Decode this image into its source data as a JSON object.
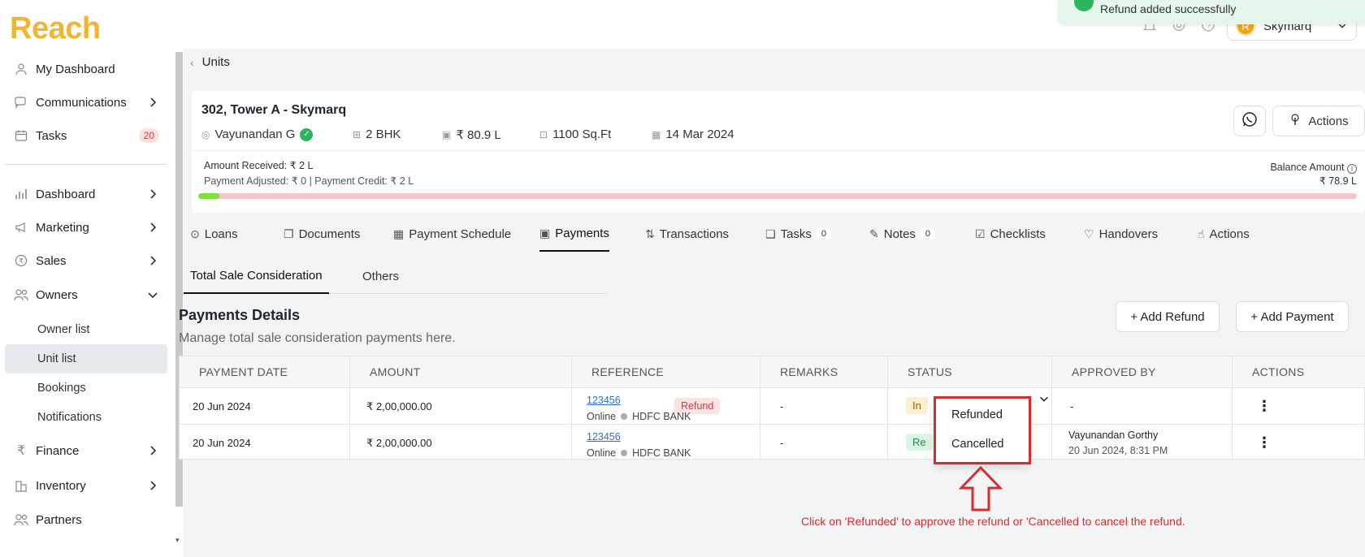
{
  "app": {
    "logo": "Reach"
  },
  "sidebar": {
    "top_items": [
      {
        "label": "My Dashboard",
        "icon": "user-icon"
      },
      {
        "label": "Communications",
        "icon": "chat-icon"
      },
      {
        "label": "Tasks",
        "icon": "calendar-icon",
        "badge": "20"
      }
    ],
    "items": [
      {
        "label": "Dashboard",
        "icon": "bar-chart-icon"
      },
      {
        "label": "Marketing",
        "icon": "megaphone-icon"
      },
      {
        "label": "Sales",
        "icon": "rupee-coin-icon"
      },
      {
        "label": "Owners",
        "icon": "users-icon"
      }
    ],
    "owners_sub": [
      "Owner list",
      "Unit list",
      "Bookings",
      "Notifications"
    ],
    "bottom_items": [
      {
        "label": "Finance",
        "icon": "rupee-icon"
      },
      {
        "label": "Inventory",
        "icon": "building-icon"
      },
      {
        "label": "Partners",
        "icon": "partners-icon"
      }
    ]
  },
  "topbar": {
    "user": "Skymarq",
    "avatar_letter": "R"
  },
  "toast": {
    "message": "Refund added successfully"
  },
  "breadcrumb": {
    "label": "Units"
  },
  "unit": {
    "title": "302, Tower A - Skymarq",
    "owner": "Vayunandan G",
    "config": "2 BHK",
    "price": "₹ 80.9 L",
    "area": "1100 Sq.Ft",
    "date": "14 Mar 2024",
    "actions_label": "Actions",
    "amount_received": "Amount Received: ₹ 2 L",
    "payment_adjusted": "Payment Adjusted: ₹ 0",
    "payment_credit": "Payment Credit: ₹ 2 L",
    "balance_label": "Balance Amount",
    "balance_value": "₹ 78.9 L",
    "progress_fraction": 0.018
  },
  "tabs": [
    {
      "label": "Loans",
      "icon": "rupee-coin-icon"
    },
    {
      "label": "Documents",
      "icon": "documents-icon"
    },
    {
      "label": "Payment Schedule",
      "icon": "calendar-icon"
    },
    {
      "label": "Payments",
      "icon": "cash-icon",
      "active": true
    },
    {
      "label": "Transactions",
      "icon": "transactions-icon"
    },
    {
      "label": "Tasks",
      "icon": "tasks-icon",
      "count": "0"
    },
    {
      "label": "Notes",
      "icon": "edit-icon",
      "count": "0"
    },
    {
      "label": "Checklists",
      "icon": "checklist-icon"
    },
    {
      "label": "Handovers",
      "icon": "handshake-icon"
    },
    {
      "label": "Actions",
      "icon": "tap-icon"
    }
  ],
  "subtabs": [
    "Total Sale Consideration",
    "Others"
  ],
  "payments": {
    "title": "Payments Details",
    "subtitle": "Manage total sale consideration payments here.",
    "add_refund": "+ Add Refund",
    "add_payment": "+ Add Payment",
    "columns": [
      "PAYMENT DATE",
      "AMOUNT",
      "REFERENCE",
      "REMARKS",
      "STATUS",
      "APPROVED BY",
      "ACTIONS"
    ],
    "rows": [
      {
        "date": "20 Jun 2024",
        "amount": "₹ 2,00,000.00",
        "tag": "Refund",
        "ref": "123456",
        "mode": "Online",
        "bank": "HDFC BANK",
        "remarks": "-",
        "status": "In",
        "approved_by": "-",
        "approved_at": ""
      },
      {
        "date": "20 Jun 2024",
        "amount": "₹ 2,00,000.00",
        "tag": "",
        "ref": "123456",
        "mode": "Online",
        "bank": "HDFC BANK",
        "remarks": "-",
        "status": "Re",
        "approved_by": "Vayunandan Gorthy",
        "approved_at": "20 Jun 2024, 8:31 PM"
      }
    ]
  },
  "dropdown": {
    "options": [
      "Refunded",
      "Cancelled"
    ]
  },
  "hint": "Click on 'Refunded' to approve the refund or 'Cancelled to cancel the refund.",
  "colors": {
    "brand": "#f2b531",
    "accent_red": "#d32e2e",
    "success": "#2db55d"
  }
}
